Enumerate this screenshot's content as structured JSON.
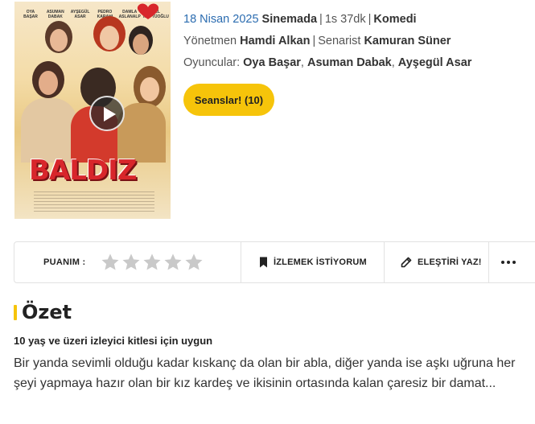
{
  "movie": {
    "release_date": "18 Nisan 2025",
    "status": "Sinemada",
    "duration": "1s 37dk",
    "genre": "Komedi",
    "director_label": "Yönetmen",
    "director": "Hamdi Alkan",
    "writer_label": "Senarist",
    "writer": "Kamuran Süner",
    "cast_label": "Oyuncular:",
    "cast": [
      "Oya Başar",
      "Asuman Dabak",
      "Ayşegül Asar"
    ]
  },
  "poster": {
    "title_text": "BALDIZ",
    "names": [
      "OYA BAŞAR",
      "ASUMAN DABAK",
      "AYŞEGÜL ASAR",
      "PEDRO KARAHI",
      "DAMLA ASLANALP",
      "EMEL MÜFTÜOĞLU"
    ]
  },
  "buttons": {
    "showtimes": "Seanslar! (10)"
  },
  "actions": {
    "rating_label": "PUANIM :",
    "rating_value": 0,
    "rating_max": 5,
    "watchlist": "İZLEMEK İSTİYORUM",
    "review": "ELEŞTİRİ YAZ!"
  },
  "summary": {
    "heading": "Özet",
    "age_rating": "10 yaş ve üzeri izleyici kitlesi için uygun",
    "text": "Bir yanda sevimli olduğu kadar kıskanç da olan bir abla, diğer yanda ise aşkı uğruna her şeyi yapmaya hazır olan bir kız kardeş ve ikisinin ortasında kalan çaresiz bir damat..."
  },
  "colors": {
    "accent": "#f6c40a",
    "date_blue": "#2b6cb0",
    "star_gray": "#c9c9c9"
  }
}
